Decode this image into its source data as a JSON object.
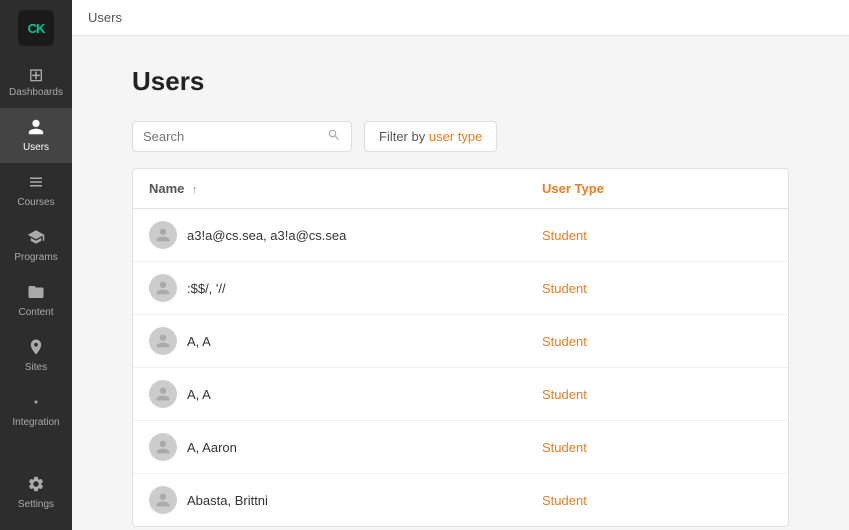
{
  "sidebar": {
    "logo": "CK",
    "items": [
      {
        "id": "dashboards",
        "label": "Dashboards",
        "icon": "⊞",
        "active": false
      },
      {
        "id": "users",
        "label": "Users",
        "icon": "👤",
        "active": true
      },
      {
        "id": "courses",
        "label": "Courses",
        "icon": "📖",
        "active": false
      },
      {
        "id": "programs",
        "label": "Programs",
        "icon": "🎓",
        "active": false
      },
      {
        "id": "content",
        "label": "Content",
        "icon": "📁",
        "active": false
      },
      {
        "id": "sites",
        "label": "Sites",
        "icon": "📍",
        "active": false
      },
      {
        "id": "integration",
        "label": "Integration",
        "icon": "⚙",
        "active": false
      }
    ],
    "settings_label": "Settings",
    "settings_icon": "⚙"
  },
  "breadcrumb": "Users",
  "page": {
    "title": "Users",
    "search_placeholder": "Search",
    "filter_label": "Filter by",
    "filter_highlight": "user type",
    "table": {
      "columns": [
        {
          "id": "name",
          "label": "Name",
          "sortable": true,
          "sort_direction": "↑"
        },
        {
          "id": "user_type",
          "label": "User Type",
          "sortable": false
        }
      ],
      "rows": [
        {
          "name": "a3!a@cs.sea, a3!a@cs.sea",
          "user_type": "Student"
        },
        {
          "name": ":$$/, '//",
          "user_type": "Student"
        },
        {
          "name": "A, A",
          "user_type": "Student"
        },
        {
          "name": "A, A",
          "user_type": "Student"
        },
        {
          "name": "A, Aaron",
          "user_type": "Student"
        },
        {
          "name": "Abasta, Brittni",
          "user_type": "Student"
        }
      ]
    }
  }
}
